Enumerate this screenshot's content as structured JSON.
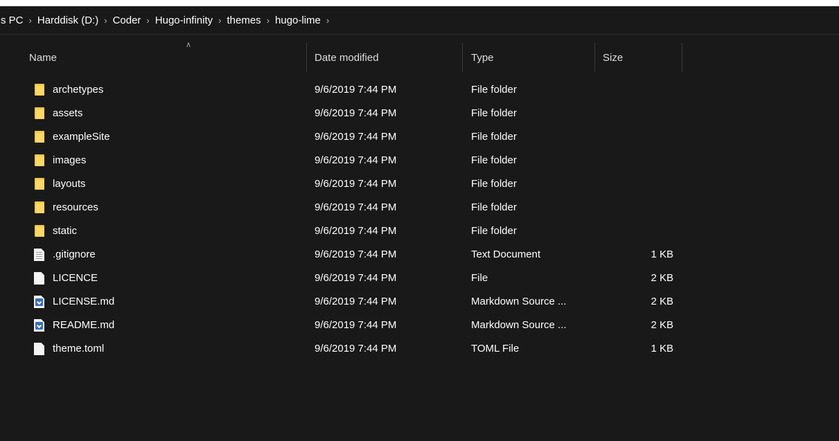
{
  "breadcrumb": [
    {
      "label": "s PC"
    },
    {
      "label": "Harddisk (D:)"
    },
    {
      "label": "Coder"
    },
    {
      "label": "Hugo-infinity"
    },
    {
      "label": "themes"
    },
    {
      "label": "hugo-lime"
    }
  ],
  "separator_icon": "chevron-right-icon",
  "columns": {
    "name": "Name",
    "date": "Date modified",
    "type": "Type",
    "size": "Size"
  },
  "sort": {
    "column": "name",
    "icon": "chevron-up-icon"
  },
  "files": [
    {
      "name": "archetypes",
      "date": "9/6/2019 7:44 PM",
      "type": "File folder",
      "size": "",
      "icon": "folder-icon"
    },
    {
      "name": "assets",
      "date": "9/6/2019 7:44 PM",
      "type": "File folder",
      "size": "",
      "icon": "folder-icon"
    },
    {
      "name": "exampleSite",
      "date": "9/6/2019 7:44 PM",
      "type": "File folder",
      "size": "",
      "icon": "folder-icon"
    },
    {
      "name": "images",
      "date": "9/6/2019 7:44 PM",
      "type": "File folder",
      "size": "",
      "icon": "folder-icon"
    },
    {
      "name": "layouts",
      "date": "9/6/2019 7:44 PM",
      "type": "File folder",
      "size": "",
      "icon": "folder-icon"
    },
    {
      "name": "resources",
      "date": "9/6/2019 7:44 PM",
      "type": "File folder",
      "size": "",
      "icon": "folder-icon"
    },
    {
      "name": "static",
      "date": "9/6/2019 7:44 PM",
      "type": "File folder",
      "size": "",
      "icon": "folder-icon"
    },
    {
      "name": ".gitignore",
      "date": "9/6/2019 7:44 PM",
      "type": "Text Document",
      "size": "1 KB",
      "icon": "text-document-icon"
    },
    {
      "name": "LICENCE",
      "date": "9/6/2019 7:44 PM",
      "type": "File",
      "size": "2 KB",
      "icon": "file-icon"
    },
    {
      "name": "LICENSE.md",
      "date": "9/6/2019 7:44 PM",
      "type": "Markdown Source ...",
      "size": "2 KB",
      "icon": "markdown-file-icon"
    },
    {
      "name": "README.md",
      "date": "9/6/2019 7:44 PM",
      "type": "Markdown Source ...",
      "size": "2 KB",
      "icon": "markdown-file-icon"
    },
    {
      "name": "theme.toml",
      "date": "9/6/2019 7:44 PM",
      "type": "TOML File",
      "size": "1 KB",
      "icon": "file-icon"
    }
  ],
  "colors": {
    "background": "#191919",
    "text": "#ffffff",
    "folder": "#ffd863",
    "markdown_badge": "#3b6fb6"
  }
}
